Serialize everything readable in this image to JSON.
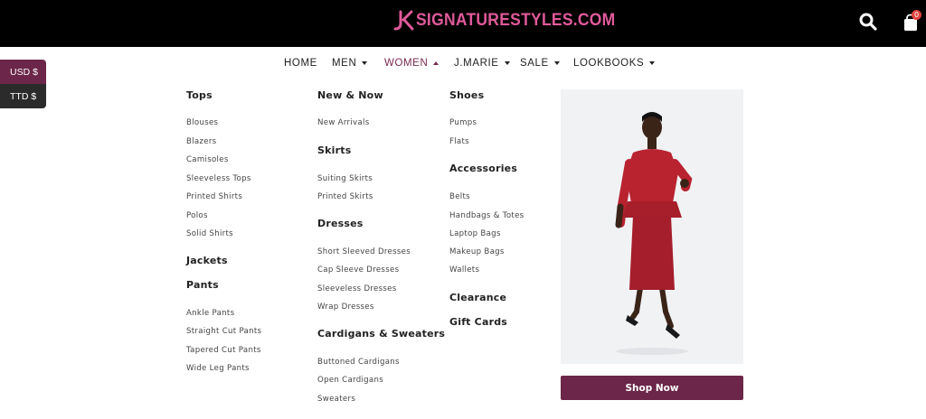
{
  "header": {
    "logo_text": "SIGNATURESTYLES.COM",
    "cart_count": "0",
    "brand_color": "#e05a9a"
  },
  "currency": {
    "usd": "USD $",
    "ttd": "TTD $"
  },
  "nav": {
    "items": [
      {
        "label": "HOME",
        "dropdown": false
      },
      {
        "label": "MEN",
        "dropdown": true
      },
      {
        "label": "WOMEN",
        "dropdown": true,
        "active": true
      },
      {
        "label": "J.MARIE",
        "dropdown": true
      },
      {
        "label": "SALE",
        "dropdown": true
      },
      {
        "label": "LOOKBOOKS",
        "dropdown": true
      }
    ]
  },
  "menu": {
    "col1": {
      "tops": "Tops",
      "tops_links": [
        "Blouses",
        "Blazers",
        "Camisoles",
        "Sleeveless Tops",
        "Printed Shirts",
        "Polos",
        "Solid Shirts"
      ],
      "jackets": "Jackets",
      "pants": "Pants",
      "pants_links": [
        "Ankle Pants",
        "Straight Cut Pants",
        "Tapered Cut Pants",
        "Wide Leg Pants"
      ]
    },
    "col2": {
      "new": "New & Now",
      "new_links": [
        "New Arrivals"
      ],
      "skirts": "Skirts",
      "skirts_links": [
        "Suiting Skirts",
        "Printed Skirts"
      ],
      "dresses": "Dresses",
      "dresses_links": [
        "Short Sleeved Dresses",
        "Cap Sleeve Dresses",
        "Sleeveless Dresses",
        "Wrap Dresses"
      ],
      "cardigans": "Cardigans & Sweaters",
      "cardigans_links": [
        "Buttoned Cardigans",
        "Open Cardigans",
        "Sweaters"
      ]
    },
    "col3": {
      "shoes": "Shoes",
      "shoes_links": [
        "Pumps",
        "Flats"
      ],
      "accessories": "Accessories",
      "accessories_links": [
        "Belts",
        "Handbags & Totes",
        "Laptop Bags",
        "Makeup Bags",
        "Wallets"
      ],
      "clearance": "Clearance",
      "gift_cards": "Gift Cards"
    }
  },
  "promo": {
    "button_label": "Shop Now",
    "accent": "#6b2649"
  }
}
